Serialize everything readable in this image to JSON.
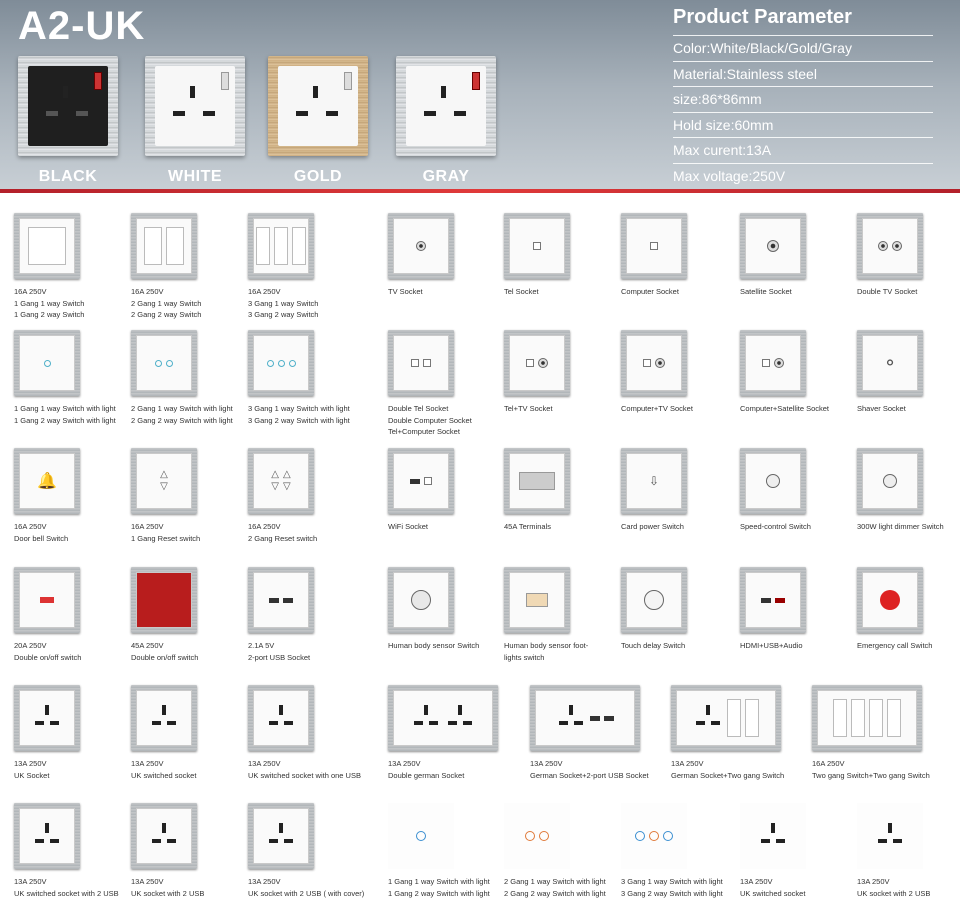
{
  "header": {
    "brand": "A2-UK",
    "colors": [
      "BLACK",
      "WHITE",
      "GOLD",
      "GRAY"
    ],
    "param_title": "Product Parameter",
    "params": [
      "Color:White/Black/Gold/Gray",
      "Material:Stainless steel",
      "size:86*86mm",
      "Hold size:60mm",
      "Max curent:13A",
      "Max voltage:250V"
    ]
  },
  "products": [
    {
      "lines": [
        "16A 250V",
        "1 Gang 1 way Switch",
        "1 Gang 2 way Switch"
      ],
      "icon": "1-gang-switch-icon"
    },
    {
      "lines": [
        "16A 250V",
        "2 Gang 1 way Switch",
        "2 Gang 2 way Switch"
      ],
      "icon": "2-gang-switch-icon"
    },
    {
      "lines": [
        "16A 250V",
        "3 Gang 1 way Switch",
        "3 Gang 2 way Switch"
      ],
      "icon": "3-gang-switch-icon"
    },
    {
      "lines": [
        "TV Socket"
      ],
      "icon": "tv-socket-icon"
    },
    {
      "lines": [
        "Tel Socket"
      ],
      "icon": "tel-socket-icon"
    },
    {
      "lines": [
        "Computer Socket"
      ],
      "icon": "computer-socket-icon"
    },
    {
      "lines": [
        "Satellite Socket"
      ],
      "icon": "satellite-socket-icon"
    },
    {
      "lines": [
        "Double TV Socket"
      ],
      "icon": "double-tv-socket-icon"
    },
    {
      "lines": [
        "1 Gang 1 way Switch with light",
        "1 Gang 2 way Switch with light"
      ],
      "icon": "1-led-switch-icon"
    },
    {
      "lines": [
        "2 Gang 1 way Switch with light",
        "2 Gang 2 way Switch with light"
      ],
      "icon": "2-led-switch-icon"
    },
    {
      "lines": [
        "3 Gang 1 way Switch with light",
        "3 Gang 2 way Switch with light"
      ],
      "icon": "3-led-switch-icon"
    },
    {
      "lines": [
        "Double Tel Socket",
        "Double Computer Socket",
        "Tel+Computer Socket"
      ],
      "icon": "double-tel-socket-icon"
    },
    {
      "lines": [
        "Tel+TV Socket"
      ],
      "icon": "tel-tv-socket-icon"
    },
    {
      "lines": [
        "Computer+TV Socket"
      ],
      "icon": "computer-tv-socket-icon"
    },
    {
      "lines": [
        "Computer+Satellite Socket"
      ],
      "icon": "computer-satellite-socket-icon"
    },
    {
      "lines": [
        "Shaver Socket"
      ],
      "icon": "shaver-socket-icon"
    },
    {
      "lines": [
        "16A 250V",
        "Door bell Switch"
      ],
      "icon": "bell-icon"
    },
    {
      "lines": [
        "16A 250V",
        "1 Gang Reset switch"
      ],
      "icon": "reset-switch-icon"
    },
    {
      "lines": [
        "16A 250V",
        "2 Gang Reset switch"
      ],
      "icon": "2-reset-switch-icon"
    },
    {
      "lines": [
        "WiFi Socket"
      ],
      "icon": "wifi-socket-icon"
    },
    {
      "lines": [
        "45A Terminals"
      ],
      "icon": "terminals-icon"
    },
    {
      "lines": [
        "Card power Switch"
      ],
      "icon": "card-switch-icon"
    },
    {
      "lines": [
        "Speed-control Switch"
      ],
      "icon": "speed-control-icon"
    },
    {
      "lines": [
        "300W light dimmer Switch"
      ],
      "icon": "dimmer-icon"
    },
    {
      "lines": [
        "20A 250V",
        "Double on/off switch"
      ],
      "icon": "20a-switch-icon"
    },
    {
      "lines": [
        "45A 250V",
        "Double on/off switch"
      ],
      "icon": "45a-switch-icon"
    },
    {
      "lines": [
        "2.1A 5V",
        "2-port USB Socket"
      ],
      "icon": "usb-socket-icon"
    },
    {
      "lines": [
        "Human body sensor Switch"
      ],
      "icon": "sensor-icon"
    },
    {
      "lines": [
        "Human body sensor foot-",
        "lights switch"
      ],
      "icon": "footlight-icon"
    },
    {
      "lines": [
        "Touch delay Switch"
      ],
      "icon": "touch-delay-icon"
    },
    {
      "lines": [
        "HDMI+USB+Audio"
      ],
      "icon": "hdmi-icon"
    },
    {
      "lines": [
        "Emergency call Switch"
      ],
      "icon": "emergency-icon"
    },
    {
      "lines": [
        "13A 250V",
        "UK Socket"
      ],
      "icon": "uk-socket-icon"
    },
    {
      "lines": [
        "13A 250V",
        "UK switched socket"
      ],
      "icon": "uk-switched-socket-icon"
    },
    {
      "lines": [
        "13A 250V",
        "UK switched socket with one USB"
      ],
      "icon": "uk-socket-usb-icon"
    },
    {
      "lines": [
        "13A 250V",
        "Double german Socket"
      ],
      "icon": "double-german-socket-icon"
    },
    {
      "lines": [
        "13A 250V",
        "German Socket+2-port USB Socket"
      ],
      "icon": "german-usb-socket-icon"
    },
    {
      "lines": [
        "13A 250V",
        "German Socket+Two gang Switch"
      ],
      "icon": "german-switch-icon"
    },
    {
      "lines": [
        "16A 250V",
        "Two gang Switch+Two gang Switch"
      ],
      "icon": "four-gang-switch-icon"
    },
    {
      "lines": [
        "13A 250V",
        "UK switched socket with 2 USB"
      ],
      "icon": "uk-2usb-switched-icon"
    },
    {
      "lines": [
        "13A 250V",
        "UK socket with 2 USB"
      ],
      "icon": "uk-2usb-icon"
    },
    {
      "lines": [
        "13A 250V",
        "UK socket with 2 USB ( with cover)"
      ],
      "icon": "uk-2usb-cover-icon"
    },
    {
      "lines": [
        "1 Gang 1 way Switch with light",
        "1 Gang 2 way Switch with light"
      ],
      "icon": "glass-1-touch-icon"
    },
    {
      "lines": [
        "2 Gang 1 way Switch with light",
        "2 Gang 2 way Switch with light"
      ],
      "icon": "glass-2-touch-icon"
    },
    {
      "lines": [
        "3 Gang 1 way Switch with light",
        "3 Gang 2 way Switch with light"
      ],
      "icon": "glass-3-touch-icon"
    },
    {
      "lines": [
        "13A 250V",
        "UK switched socket"
      ],
      "icon": "white-uk-switched-icon"
    },
    {
      "lines": [
        "13A 250V",
        "UK socket with 2 USB"
      ],
      "icon": "white-uk-2usb-icon"
    }
  ]
}
